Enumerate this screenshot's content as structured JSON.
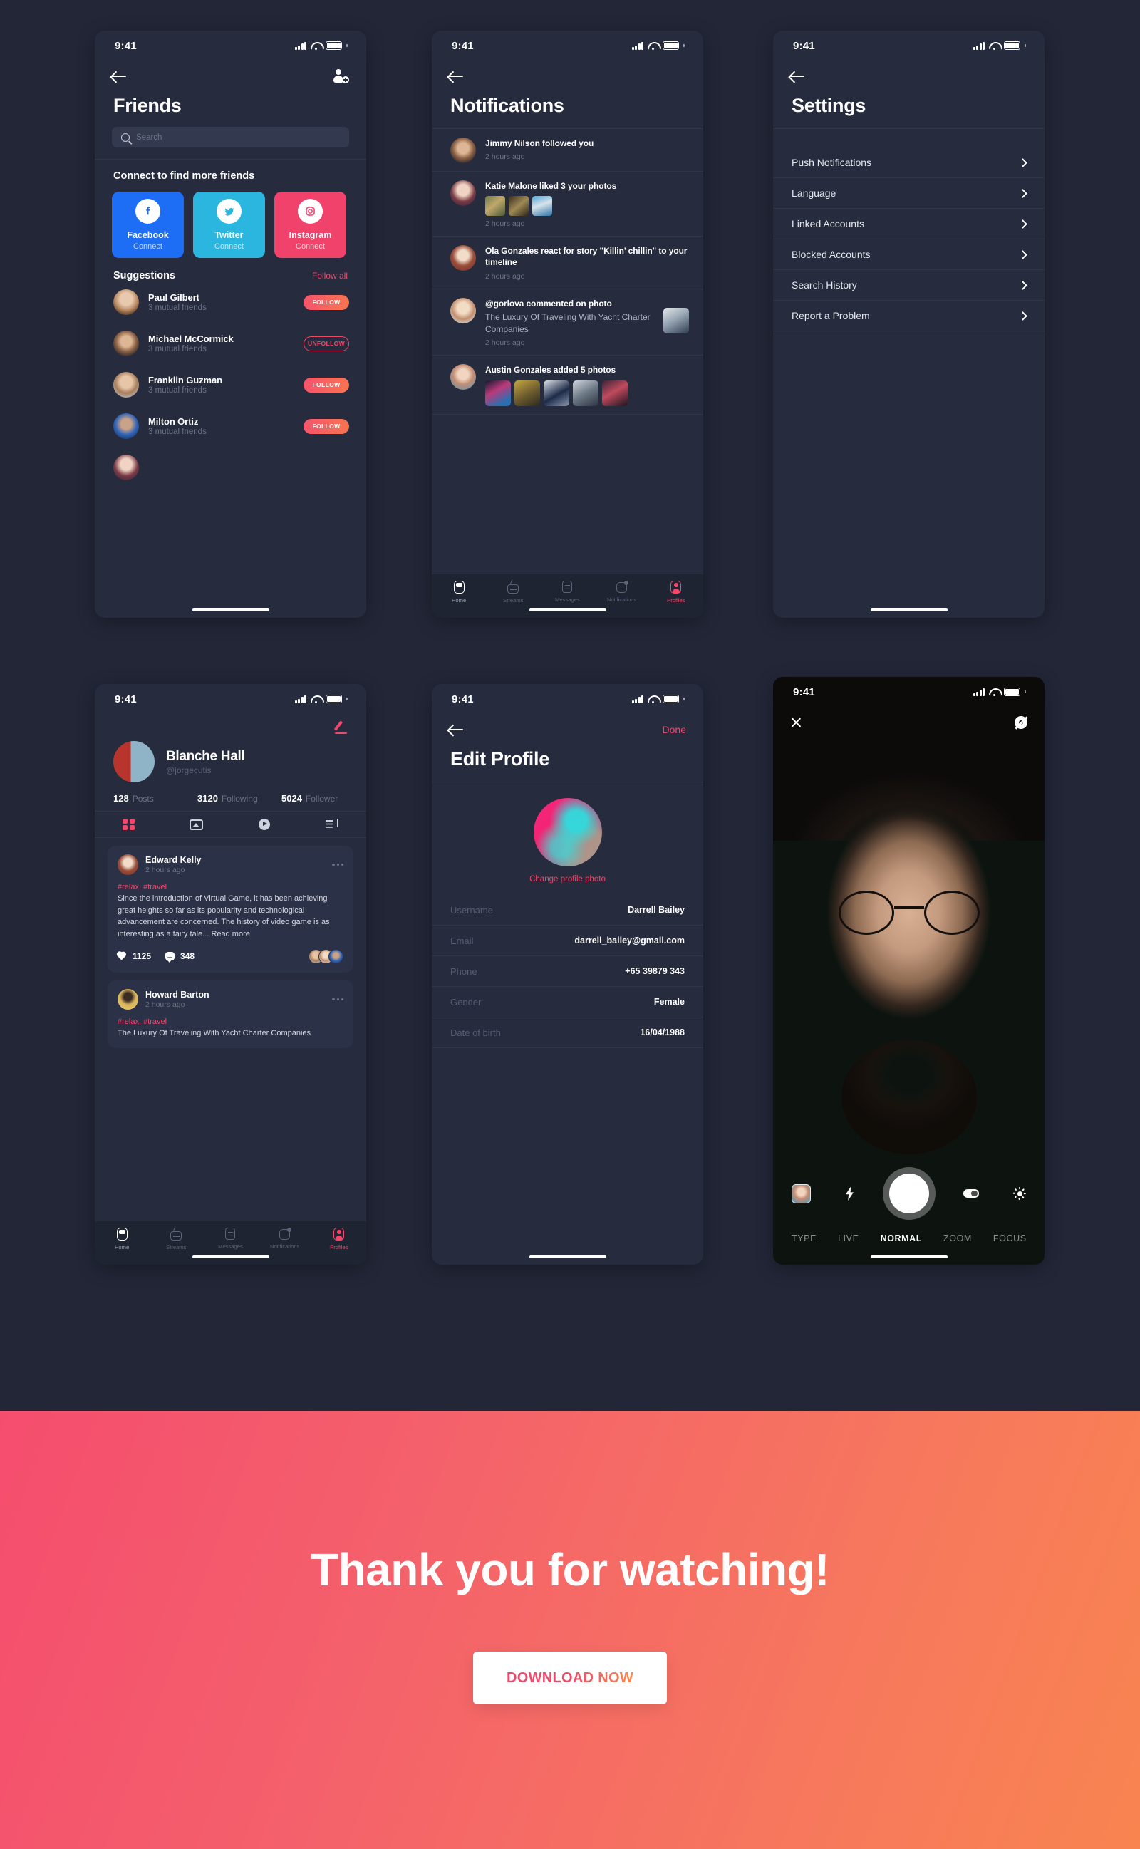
{
  "status_bar": {
    "time": "9:41"
  },
  "colors": {
    "accent": "#f0476b",
    "bg": "#222637",
    "surface": "#262b3d",
    "card": "#2b3146"
  },
  "friends_screen": {
    "title": "Friends",
    "search_placeholder": "Search",
    "connect_heading": "Connect to find more friends",
    "connect_cards": [
      {
        "name": "Facebook",
        "sub": "Connect",
        "icon": "facebook-icon"
      },
      {
        "name": "Twitter",
        "sub": "Connect",
        "icon": "twitter-icon"
      },
      {
        "name": "Instagram",
        "sub": "Connect",
        "icon": "instagram-icon"
      }
    ],
    "suggestions_heading": "Suggestions",
    "follow_all_label": "Follow all",
    "suggestions": [
      {
        "name": "Paul Gilbert",
        "mutual": "3 mutual friends",
        "action": "FOLLOW",
        "state": "follow"
      },
      {
        "name": "Michael McCormick",
        "mutual": "3 mutual friends",
        "action": "UNFOLLOW",
        "state": "unfollow"
      },
      {
        "name": "Franklin Guzman",
        "mutual": "3 mutual friends",
        "action": "FOLLOW",
        "state": "follow"
      },
      {
        "name": "Milton Ortiz",
        "mutual": "3 mutual friends",
        "action": "FOLLOW",
        "state": "follow"
      }
    ]
  },
  "notifications_screen": {
    "title": "Notifications",
    "items": [
      {
        "text": "Jimmy Nilson followed you",
        "time": "2 hours ago",
        "thumbs": 0
      },
      {
        "text": "Katie Malone liked 3 your photos",
        "time": "2 hours ago",
        "thumbs": 3
      },
      {
        "text": "Ola Gonzales react for story \"Killin’ chillin\" to your timeline",
        "time": "2 hours ago",
        "thumbs": 0
      },
      {
        "text": "@gorlova commented on photo",
        "sub": "The Luxury Of Traveling With Yacht Charter Companies",
        "time": "2 hours ago",
        "thumbs": 0,
        "right_thumb": true
      },
      {
        "text": "Austin Gonzales added 5 photos",
        "time": "2 hours ago",
        "thumbs": 5
      }
    ]
  },
  "settings_screen": {
    "title": "Settings",
    "items": [
      "Push Notifications",
      "Language",
      "Linked Accounts",
      "Blocked Accounts",
      "Search History",
      "Report a Problem"
    ]
  },
  "profile_screen": {
    "name": "Blanche Hall",
    "handle": "@jorgecutis",
    "stats": [
      {
        "number": "128",
        "label": "Posts"
      },
      {
        "number": "3120",
        "label": "Following"
      },
      {
        "number": "5024",
        "label": "Follower"
      }
    ],
    "tabs": [
      "grid-icon",
      "image-icon",
      "play-icon",
      "playlist-icon"
    ],
    "posts": [
      {
        "author": "Edward Kelly",
        "time": "2 hours ago",
        "tags": "#relax, #travel",
        "text": "Since the introduction of Virtual Game, it has been achieving great heights so far as its popularity and technological advancement are concerned. The history of video game is as interesting as a fairy tale... Read more",
        "likes": "1125",
        "comments": "348"
      },
      {
        "author": "Howard Barton",
        "time": "2 hours ago",
        "tags": "#relax, #travel",
        "text": "The Luxury Of Traveling With Yacht Charter Companies"
      }
    ]
  },
  "edit_profile_screen": {
    "title": "Edit Profile",
    "done_label": "Done",
    "change_photo_label": "Change profile photo",
    "fields": [
      {
        "label": "Username",
        "value": "Darrell Bailey"
      },
      {
        "label": "Email",
        "value": "darrell_bailey@gmail.com"
      },
      {
        "label": "Phone",
        "value": "+65 39879 343"
      },
      {
        "label": "Gender",
        "value": "Female"
      },
      {
        "label": "Date of birth",
        "value": "16/04/1988"
      }
    ]
  },
  "camera_screen": {
    "modes": [
      "TYPE",
      "LIVE",
      "NORMAL",
      "ZOOM",
      "FOCUS"
    ],
    "active_mode": "NORMAL"
  },
  "tabbar": [
    {
      "label": "Home",
      "icon": "home-icon",
      "active": false
    },
    {
      "label": "Streams",
      "icon": "tv-icon",
      "active": false
    },
    {
      "label": "Messages",
      "icon": "message-icon",
      "active": false
    },
    {
      "label": "Notifications",
      "icon": "notification-icon",
      "active": false
    },
    {
      "label": "Profiles",
      "icon": "profile-icon",
      "active": true
    }
  ],
  "banner": {
    "headline": "Thank you for watching!",
    "cta_label": "DOWNLOAD NOW"
  }
}
